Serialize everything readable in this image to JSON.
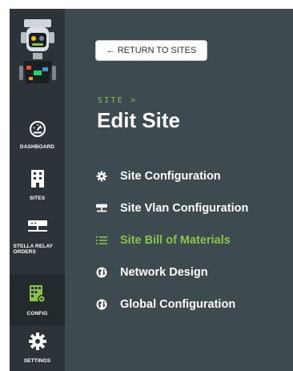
{
  "sidebar": {
    "items": [
      {
        "label": "DASHBOARD",
        "icon": "dashboard-gauge-icon",
        "active": false
      },
      {
        "label": "SITES",
        "icon": "building-icon",
        "active": false
      },
      {
        "label": "STELLA RELAY ORDERS",
        "icon": "network-switch-icon",
        "active": false
      },
      {
        "label": "CONFIG",
        "icon": "config-grid-gear-icon",
        "active": true
      },
      {
        "label": "SETTINGS",
        "icon": "gear-icon",
        "active": false
      }
    ]
  },
  "header": {
    "return_label": "RETURN TO SITES",
    "breadcrumb": "SITE >",
    "title": "Edit Site"
  },
  "menu": {
    "items": [
      {
        "label": "Site Configuration",
        "icon": "gear-icon",
        "active": false
      },
      {
        "label": "Site Vlan Configuration",
        "icon": "network-switch-icon",
        "active": false
      },
      {
        "label": "Site Bill of Materials",
        "icon": "list-icon",
        "active": true
      },
      {
        "label": "Network Design",
        "icon": "globe-icon",
        "active": false
      },
      {
        "label": "Global Configuration",
        "icon": "globe-icon",
        "active": false
      }
    ]
  },
  "colors": {
    "accent": "#8bc34a",
    "sidebar_bg": "#2c3439",
    "main_bg": "#3d4a50"
  }
}
